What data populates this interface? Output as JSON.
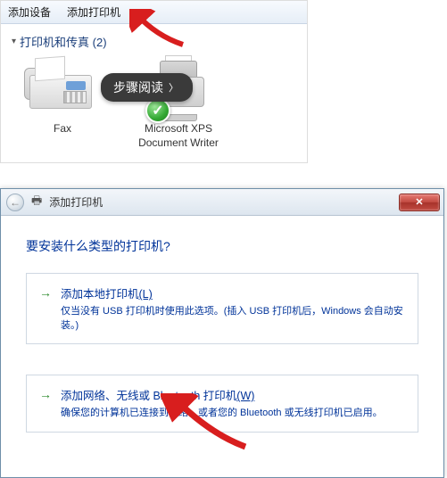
{
  "toolbar": {
    "add_device": "添加设备",
    "add_printer": "添加打印机"
  },
  "category": {
    "label": "打印机和传真 (2)"
  },
  "devices": [
    {
      "name": "Fax",
      "icon": "fax-icon"
    },
    {
      "name": "Microsoft XPS Document Writer",
      "icon": "printer-icon"
    }
  ],
  "step_badge": {
    "label": "步骤阅读"
  },
  "wizard": {
    "title": "添加打印机",
    "heading": "要安装什么类型的打印机?",
    "option1": {
      "title_pre": "添加本地打印机",
      "title_accel": "(L)",
      "desc": "仅当没有 USB 打印机时使用此选项。(插入 USB 打印机后，Windows 会自动安装。)"
    },
    "option2": {
      "title_pre": "添加网络、无线或 Bluetooth 打印机",
      "title_accel": "(W)",
      "desc": "确保您的计算机已连接到网络，或者您的 Bluetooth 或无线打印机已启用。"
    }
  }
}
